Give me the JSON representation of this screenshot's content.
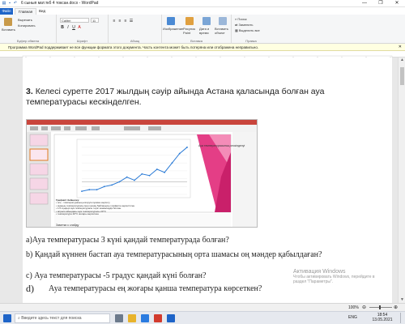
{
  "window": {
    "title": "6 сынып мат.ткб 4 токсан.docx - WordPad",
    "minimize": "—",
    "maximize": "❐",
    "close": "✕"
  },
  "ribbon_tabs": [
    "Файл",
    "Главная",
    "Вид"
  ],
  "ribbon": {
    "clipboard": {
      "paste_label": "Вставить",
      "cut_label": "Вырезать",
      "copy_label": "Копировать",
      "group_label": "Буфер обмена"
    },
    "font": {
      "font_name": "Calibri",
      "font_size": "11",
      "group_label": "Шрифт"
    },
    "paragraph": {
      "group_label": "Абзац"
    },
    "insert": {
      "image_label": "Изображение",
      "paint_label": "Рисунок Paint",
      "datetime_label": "Дата и время",
      "object_label": "Вставить объект",
      "group_label": "Вставка"
    },
    "editing": {
      "find_label": "Поиск",
      "replace_label": "Заменить",
      "selectall_label": "Выделить все",
      "group_label": "Правка"
    }
  },
  "infobar": {
    "message": "Программа WordPad поддерживает не все функции формата этого документа. Часть контента может быть потеряна или отображена неправильно."
  },
  "document": {
    "q3_number": "3.",
    "q3_text": "Келесі суретте 2017 жылдың сәуір айында Астана қаласында болған ауа температурасы кескінделген.",
    "qa": "а)Ауа температурасы  3 күні қандай температурада болған?",
    "qb": "b) Қандай күннен бастап  ауа температурасының орта шамасы оң мәндер қабылдаған?",
    "qc": "c) Ауа температурасы  -5 градус  қандай  күні болған?",
    "qd_letter": "d)",
    "qd": "Ауа температурасы   ең жоғары қанша температура көрсеткен?"
  },
  "screenshot": {
    "slide_title": "Ауа температурасының кескінделуі",
    "notes_title": "Графикті бейнелеу:",
    "notes_lines": [
      "• ось - температураның өзгеруін күнмен көрсету",
      "• ауаның температурасы мен күннің байланысы графикте көрсетілген",
      "• 1-5 күндері ауа температурасы теріс шамаларда болған",
      "• апреля айындағы ауа температурасы 20°C",
      "• температура 20°C жоғары көрсеткен"
    ],
    "notes_footer": "Заметки к слайду",
    "chart_data": {
      "type": "line",
      "title": "",
      "xlabel": "",
      "ylabel": "",
      "x": [
        1,
        3,
        5,
        7,
        9,
        11,
        13,
        15,
        17,
        19,
        21,
        23,
        25,
        27,
        29
      ],
      "y": [
        -6,
        -5,
        -5,
        -3,
        -2,
        0,
        3,
        1,
        5,
        4,
        8,
        6,
        12,
        18,
        22
      ],
      "ylim": [
        -8,
        25
      ],
      "color": "#2b7bd6"
    }
  },
  "watermark": {
    "title": "Активация Windows",
    "line1": "Чтобы активировать Windows, перейдите в",
    "line2": "раздел \"Параметры\"."
  },
  "status": {
    "zoom": "100%"
  },
  "taskbar": {
    "search_placeholder": "Введите здесь текст для поиска",
    "time": "18:54",
    "date": "13.05.2021",
    "lang": "ENG"
  }
}
